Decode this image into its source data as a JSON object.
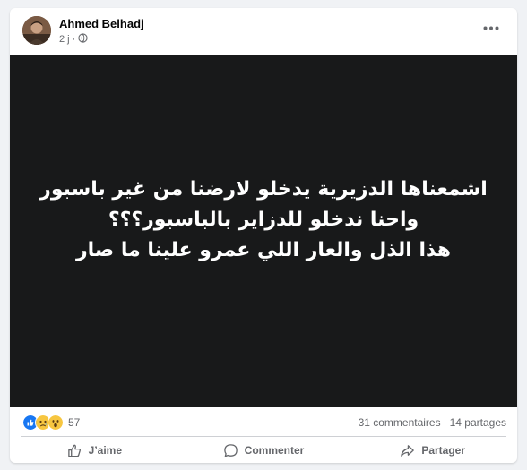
{
  "post": {
    "author": "Ahmed Belhadj",
    "time": "2 j",
    "privacy_icon": "globe-icon",
    "image_text": [
      "اشمعناها الدزيرية يدخلو لارضنا من غير باسبور",
      "واحنا ندخلو للدزاير بالباسبور؟؟؟",
      "هذا الذل والعار اللي عمرو علينا ما صار"
    ],
    "reactions": {
      "icons": [
        "like-icon",
        "sad-icon",
        "wow-icon"
      ],
      "count": "57"
    },
    "comments": "31 commentaires",
    "shares": "14 partages"
  },
  "actions": {
    "like": "J’aime",
    "comment": "Commenter",
    "share": "Partager"
  },
  "colors": {
    "background": "#f0f2f5",
    "card": "#ffffff",
    "image_bg": "#18191a",
    "like_blue": "#1877f2",
    "secondary_text": "#65676b"
  }
}
